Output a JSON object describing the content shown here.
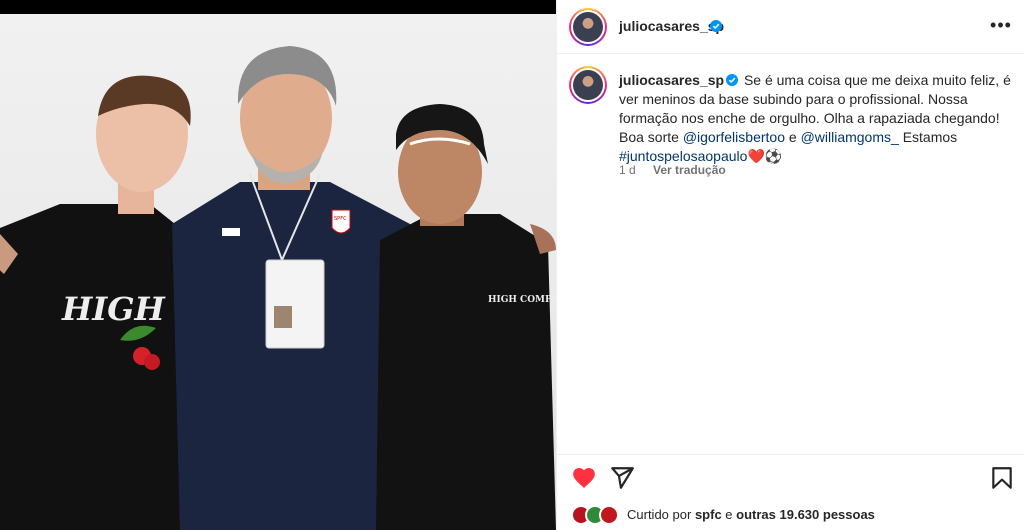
{
  "post": {
    "username": "juliocasares_sp",
    "verified_icon": "verified-badge-icon",
    "more_icon": "more-options-icon"
  },
  "caption": {
    "username": "juliocasares_sp",
    "text_1": "Se é uma coisa que me deixa muito feliz, é ver meninos da base subindo para o profissional. Nossa formação nos enche de orgulho. Olha a rapaziada chegando! Boa sorte",
    "mention_1": "@igorfelisbertoo",
    "connector": "e",
    "mention_2": "@williamgoms_",
    "text_2": "Estamos",
    "hashtag": "#juntospelosaopaulo",
    "emoji": "❤️⚽"
  },
  "meta": {
    "time": "1 d",
    "translate": "Ver tradução"
  },
  "actions": {
    "like_icon": "heart-filled-icon",
    "share_icon": "send-icon",
    "save_icon": "bookmark-icon",
    "liked_by_prefix": "Curtido por",
    "liked_by_user": "spfc",
    "liked_by_and": "e",
    "liked_by_others": "outras 19.630 pessoas",
    "like_color": "#ff3040"
  },
  "photo": {
    "shirt_text_left": "HIGH CO",
    "shirt_text_right": "HIGH COMPANY",
    "badge_text": "SPFC"
  }
}
